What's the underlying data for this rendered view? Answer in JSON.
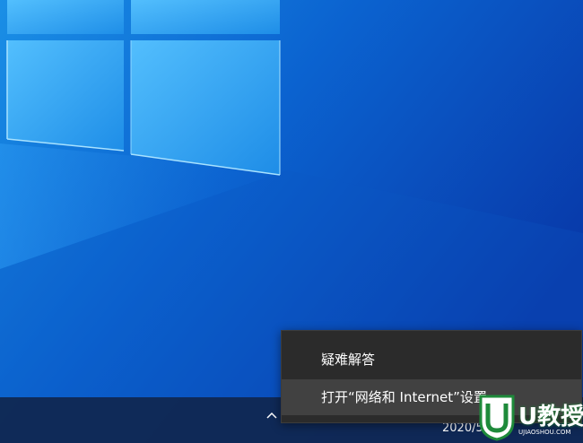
{
  "colors": {
    "desktop_light": "#1a8fe6",
    "desktop_dark": "#0838a8",
    "taskbar_bg": "#10264e",
    "menu_bg": "#2b2b2b",
    "menu_hover": "#414141",
    "watermark_green": "#1e8a3a"
  },
  "context_menu": {
    "items": [
      {
        "label": "疑难解答",
        "highlighted": false
      },
      {
        "label": "打开“网络和 Internet”设置",
        "highlighted": true
      }
    ]
  },
  "taskbar": {
    "tray": {
      "chevron_icon": "chevron-up-icon",
      "icons": [
        "windows-security-icon",
        "network-icon",
        "input-method-icon",
        "volume-icon"
      ],
      "date_fragment": "2020/5/7"
    }
  },
  "watermark": {
    "logo_icon": "u-shield-logo",
    "text": "U教授",
    "url": "UJIAOSHOU.COM"
  }
}
